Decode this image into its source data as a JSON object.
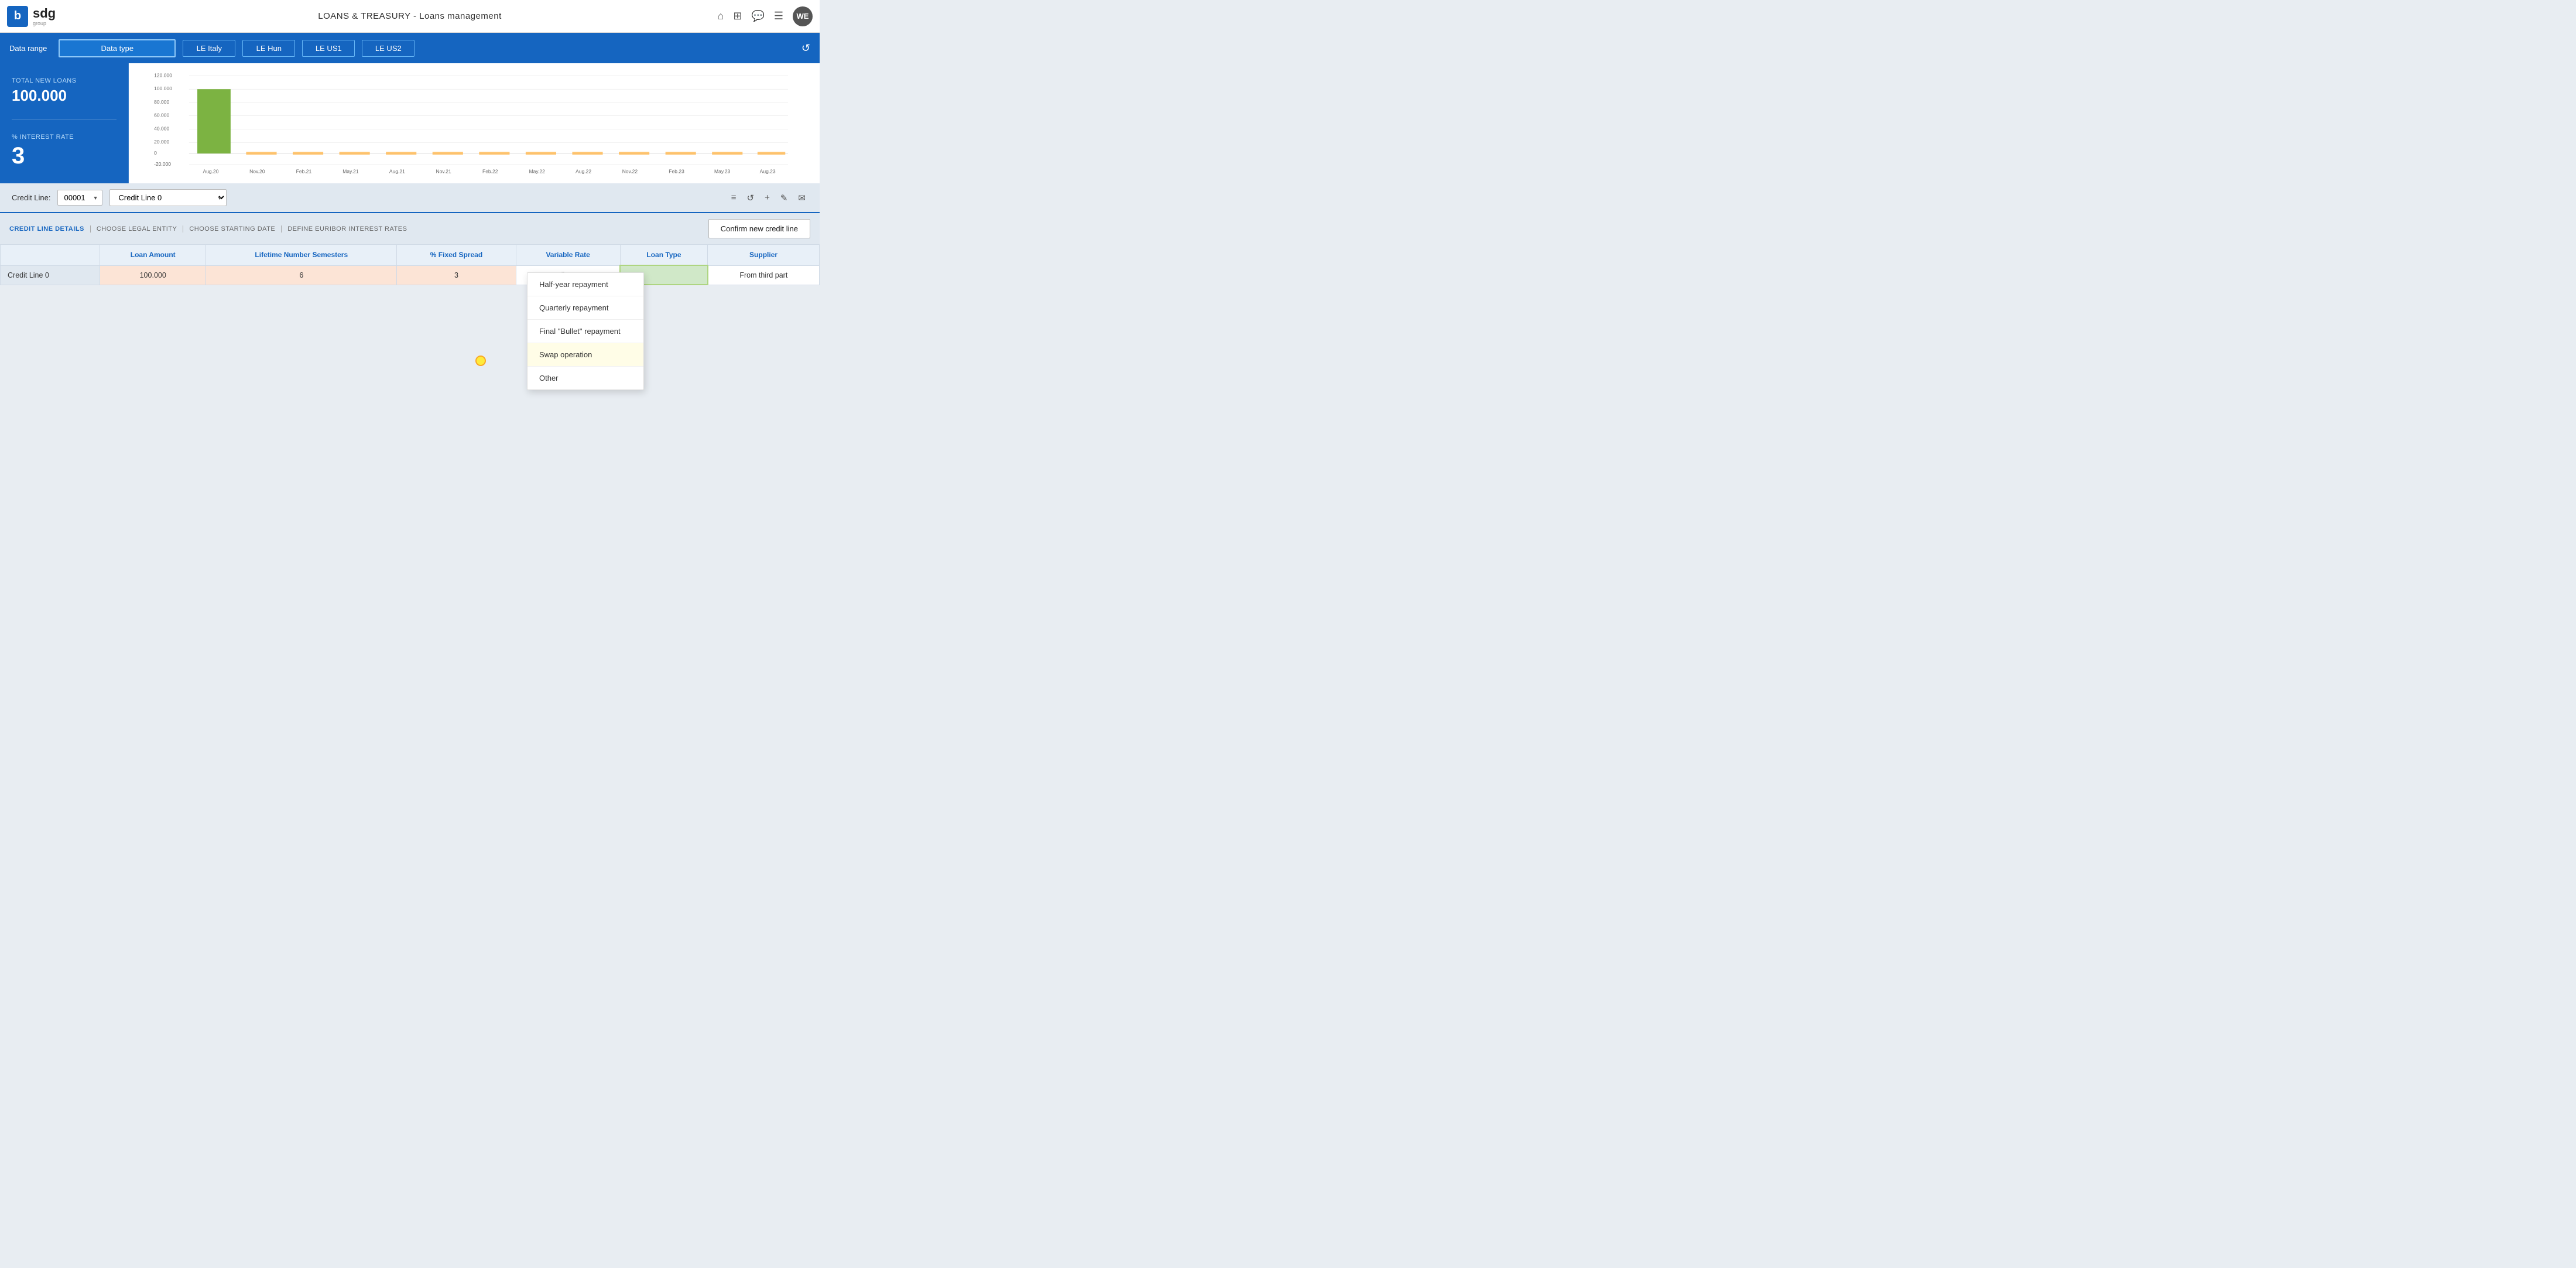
{
  "app": {
    "logo_letter": "b",
    "logo_name": "sdg",
    "logo_sub": "group",
    "title": "LOANS & TREASURY - Loans management",
    "avatar": "WE"
  },
  "filter_bar": {
    "data_range_label": "Data range",
    "data_type_label": "Data type",
    "le_buttons": [
      "LE Italy",
      "LE Hun",
      "LE US1",
      "LE US2"
    ],
    "refresh_icon": "↺"
  },
  "stats": {
    "total_loans_label": "TOTAL NEW LOANS",
    "total_loans_value": "100.000",
    "interest_rate_label": "% INTEREST RATE",
    "interest_rate_value": "3"
  },
  "chart": {
    "y_labels": [
      "120.000",
      "100.000",
      "80.000",
      "60.000",
      "40.000",
      "20.000",
      "0",
      "-20.000"
    ],
    "x_labels": [
      "Aug.20",
      "Nov.20",
      "Feb.21",
      "May.21",
      "Aug.21",
      "Nov.21",
      "Feb.22",
      "May.22",
      "Aug.22",
      "Nov.22",
      "Feb.23",
      "May.23",
      "Aug.23"
    ]
  },
  "credit_line_bar": {
    "label": "Credit Line:",
    "code": "00001",
    "name": "Credit Line 0",
    "toolbar_icons": [
      "≡",
      "↺",
      "+",
      "✎",
      "✉"
    ]
  },
  "section_tabs": [
    "CREDIT LINE DETAILS",
    "CHOOSE LEGAL ENTITY",
    "CHOOSE STARTING DATE",
    "DEFINE EURIBOR INTEREST RATES"
  ],
  "confirm_btn": "Confirm new credit line",
  "table": {
    "headers": [
      "",
      "Loan Amount",
      "Lifetime Number Semesters",
      "% Fixed Spread",
      "Variable Rate",
      "Loan Type",
      "Supplier"
    ],
    "rows": [
      {
        "label": "Credit Line 0",
        "loan_amount": "100.000",
        "semesters": "6",
        "fixed_spread": "3",
        "variable_rate": "Euribor 1m",
        "loan_type": "",
        "supplier": "From third part"
      }
    ]
  },
  "dropdown": {
    "items": [
      "Half-year repayment",
      "Quarterly repayment",
      "Final \"Bullet\" repayment",
      "Swap operation",
      "Other"
    ],
    "highlighted": "Swap operation"
  }
}
